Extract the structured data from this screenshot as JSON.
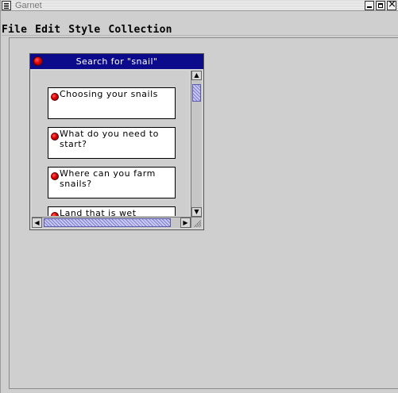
{
  "window": {
    "title": "Garnet",
    "controls": {
      "minimize": "minimize-icon",
      "maximize": "maximize-icon",
      "close": "close-icon"
    }
  },
  "menubar": {
    "items": [
      "File",
      "Edit",
      "Style",
      "Collection"
    ]
  },
  "search_window": {
    "title": "Search for \"snail\"",
    "title_bar_color": "#0b0b8c",
    "results": [
      "Choosing your snails",
      "What do you need to start?",
      "Where can you farm snails?",
      "Land that is wet"
    ]
  },
  "colors": {
    "accent": "#0b0b8c",
    "marker": "#e00000",
    "background": "#cfcfcf"
  }
}
